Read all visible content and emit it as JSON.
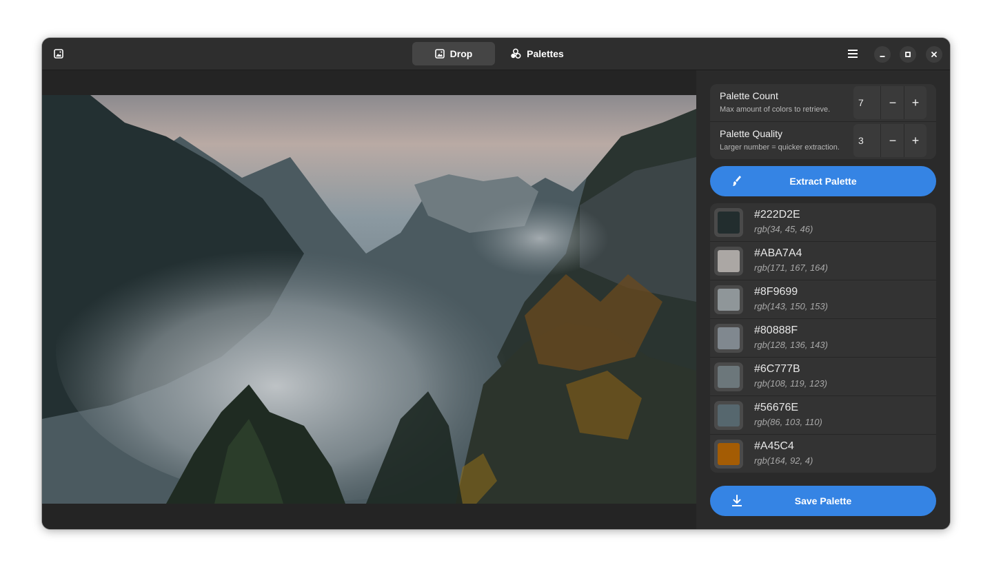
{
  "header": {
    "app_icon": "image-icon",
    "tabs": [
      {
        "label": "Drop",
        "icon": "image-icon",
        "active": true
      },
      {
        "label": "Palettes",
        "icon": "palette-icon",
        "active": false
      }
    ],
    "menu_icon": "hamburger-menu-icon",
    "window_controls": [
      "minimize-icon",
      "maximize-icon",
      "close-icon"
    ]
  },
  "image": {
    "description_icon": "photo"
  },
  "settings": {
    "palette_count": {
      "title": "Palette Count",
      "subtitle": "Max amount of colors to retrieve.",
      "value": "7"
    },
    "palette_quality": {
      "title": "Palette Quality",
      "subtitle": "Larger number = quicker extraction.",
      "value": "3"
    },
    "minus": "−",
    "plus": "+"
  },
  "extract_button": {
    "label": "Extract Palette",
    "icon": "brush-icon"
  },
  "colors": [
    {
      "hex": "#222D2E",
      "rgb": "rgb(34, 45, 46)",
      "swatch": "#222D2E"
    },
    {
      "hex": "#ABA7A4",
      "rgb": "rgb(171, 167, 164)",
      "swatch": "#ABA7A4"
    },
    {
      "hex": "#8F9699",
      "rgb": "rgb(143, 150, 153)",
      "swatch": "#8F9699"
    },
    {
      "hex": "#80888F",
      "rgb": "rgb(128, 136, 143)",
      "swatch": "#80888F"
    },
    {
      "hex": "#6C777B",
      "rgb": "rgb(108, 119, 123)",
      "swatch": "#6C777B"
    },
    {
      "hex": "#56676E",
      "rgb": "rgb(86, 103, 110)",
      "swatch": "#56676E"
    },
    {
      "hex": "#A45C4",
      "rgb": "rgb(164, 92, 4)",
      "swatch": "#A45C04"
    }
  ],
  "save_button": {
    "label": "Save Palette",
    "icon": "download-icon"
  },
  "theme": {
    "accent": "#3584e4",
    "window_bg": "#242424",
    "headerbar_bg": "#2e2e2e"
  }
}
